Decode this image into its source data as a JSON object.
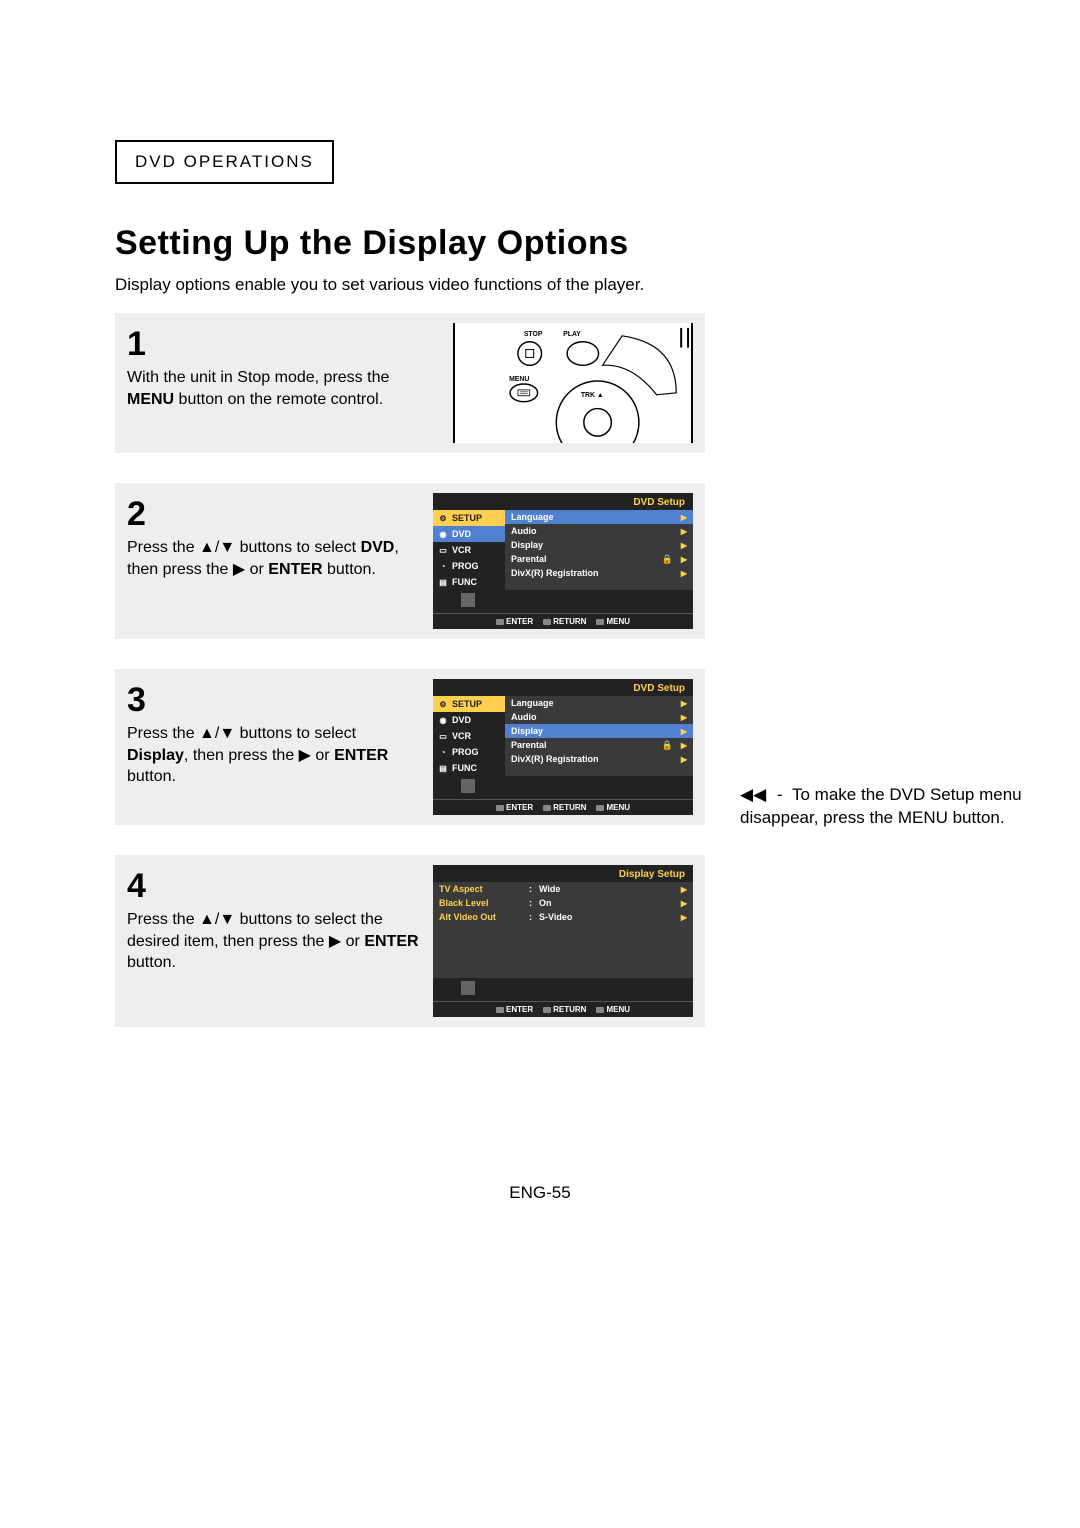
{
  "header": "DVD OPERATIONS",
  "title": "Setting Up the Display Options",
  "intro": "Display options enable you to set various video functions of the player.",
  "steps": {
    "s1": {
      "num": "1",
      "pre": "With the unit in Stop mode, press the ",
      "bold": "MENU",
      "post": " button on the remote control."
    },
    "s2": {
      "num": "2",
      "pre": "Press the ▲/▼ buttons to select ",
      "bold": "DVD",
      "mid": ", then press the ▶ or ",
      "bold2": "ENTER",
      "post": " button."
    },
    "s3": {
      "num": "3",
      "pre": "Press the ▲/▼ buttons to select ",
      "bold": "Display",
      "mid": ", then press the ▶ or ",
      "bold2": "ENTER",
      "post": " button."
    },
    "s4": {
      "num": "4",
      "pre": "Press the ▲/▼ buttons to select the desired item, then press the ▶ or ",
      "bold": "ENTER",
      "post": " button."
    }
  },
  "remote": {
    "stop": "STOP",
    "play": "PLAY",
    "menu": "MENU",
    "trk": "TRK ▲"
  },
  "osd": {
    "dvd_setup": "DVD Setup",
    "display_setup": "Display Setup",
    "sidebar": {
      "setup": "SETUP",
      "dvd": "DVD",
      "vcr": "VCR",
      "prog": "PROG",
      "func": "FUNC"
    },
    "menu": {
      "language": "Language",
      "audio": "Audio",
      "display": "Display",
      "parental": "Parental",
      "divx": "DivX(R) Registration"
    },
    "footer": {
      "enter": "ENTER",
      "return": "RETURN",
      "menu": "MENU"
    },
    "display_menu": {
      "tv_aspect": {
        "k": "TV Aspect",
        "v": "Wide"
      },
      "black_level": {
        "k": "Black Level",
        "v": "On"
      },
      "alt_video": {
        "k": "Alt Video Out",
        "v": "S-Video"
      }
    }
  },
  "note": {
    "text": "To make the DVD Setup menu disappear, press the MENU button."
  },
  "page_num": "ENG-55"
}
